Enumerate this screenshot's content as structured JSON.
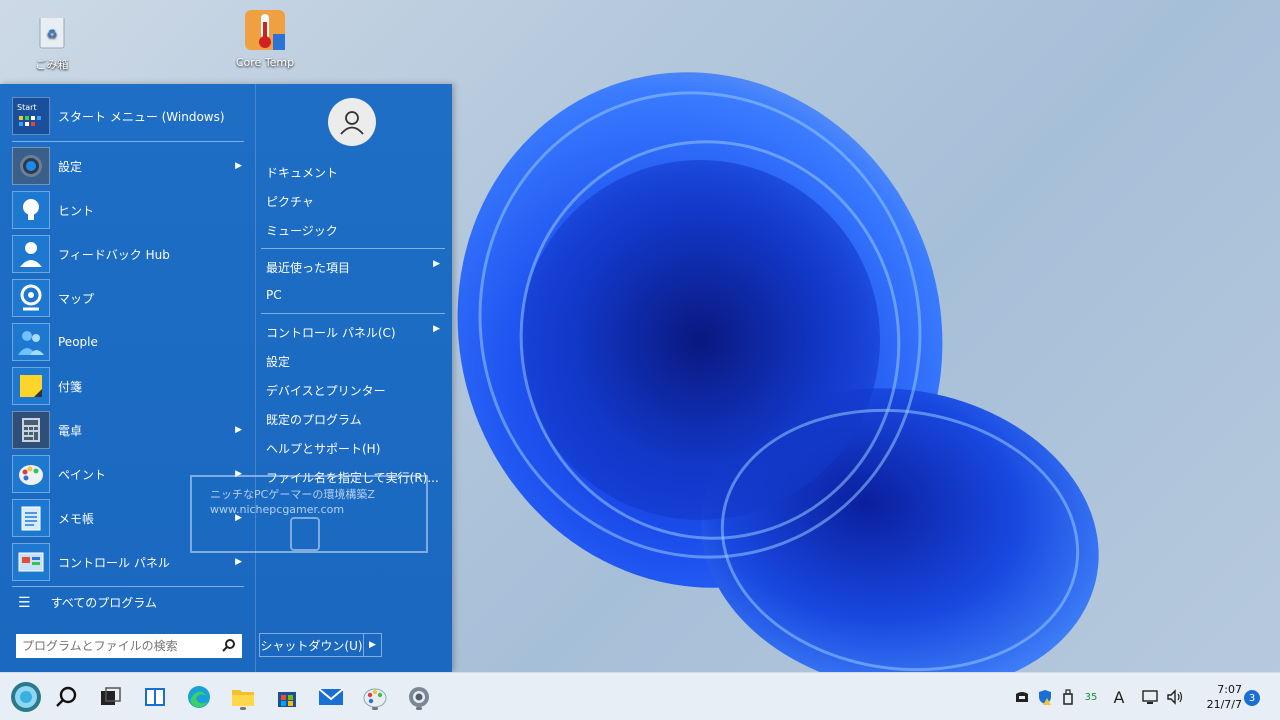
{
  "desktop": {
    "icons": [
      {
        "label": "ごみ箱",
        "icon": "recycle-bin-icon"
      },
      {
        "label": "Core Temp",
        "icon": "thermometer-icon"
      }
    ]
  },
  "start_menu": {
    "pinned": [
      {
        "label": "スタート メニュー (Windows)",
        "icon": "start-tile-icon",
        "arrow": false
      },
      {
        "label": "設定",
        "icon": "gear-icon",
        "arrow": true
      },
      {
        "label": "ヒント",
        "icon": "lightbulb-icon",
        "arrow": false
      },
      {
        "label": "フィードバック Hub",
        "icon": "person-feedback-icon",
        "arrow": false
      },
      {
        "label": "マップ",
        "icon": "map-pin-icon",
        "arrow": false
      },
      {
        "label": "People",
        "icon": "people-icon",
        "arrow": false
      },
      {
        "label": "付箋",
        "icon": "sticky-note-icon",
        "arrow": false
      },
      {
        "label": "電卓",
        "icon": "calculator-icon",
        "arrow": true
      },
      {
        "label": "ペイント",
        "icon": "paint-palette-icon",
        "arrow": true
      },
      {
        "label": "メモ帳",
        "icon": "notepad-icon",
        "arrow": true
      },
      {
        "label": "コントロール パネル",
        "icon": "control-panel-icon",
        "arrow": true
      }
    ],
    "all_programs": "すべてのプログラム",
    "search_placeholder": "プログラムとファイルの検索",
    "right_items": [
      {
        "label": "ドキュメント",
        "arrow": false
      },
      {
        "label": "ピクチャ",
        "arrow": false
      },
      {
        "label": "ミュージック",
        "arrow": false
      },
      {
        "label": "最近使った項目",
        "arrow": true
      },
      {
        "label": "PC",
        "arrow": false
      },
      {
        "label": "コントロール パネル(C)",
        "arrow": true
      },
      {
        "label": "設定",
        "arrow": false
      },
      {
        "label": "デバイスとプリンター",
        "arrow": false
      },
      {
        "label": "既定のプログラム",
        "arrow": false
      },
      {
        "label": "ヘルプとサポート(H)",
        "arrow": false
      },
      {
        "label": "ファイル名を指定して実行(R)...",
        "arrow": false
      }
    ],
    "shutdown_label": "シャットダウン(U)"
  },
  "watermark": {
    "line1": "ニッチなPCゲーマーの環境構築Z",
    "line2": "www.nichepcgamer.com"
  },
  "taskbar": {
    "apps": [
      {
        "name": "start-orb-icon",
        "running": false
      },
      {
        "name": "search-icon",
        "running": false
      },
      {
        "name": "task-view-icon",
        "running": false
      },
      {
        "name": "widgets-icon",
        "running": false
      },
      {
        "name": "edge-icon",
        "running": false
      },
      {
        "name": "file-explorer-icon",
        "running": true
      },
      {
        "name": "store-icon",
        "running": false
      },
      {
        "name": "mail-icon",
        "running": false
      },
      {
        "name": "paint-icon",
        "running": true
      },
      {
        "name": "settings-icon",
        "running": true
      }
    ],
    "tray": {
      "temp_value": "35",
      "ime": "A"
    },
    "clock": {
      "time": "7:07",
      "date": "21/7/7"
    },
    "notification_count": "3"
  }
}
